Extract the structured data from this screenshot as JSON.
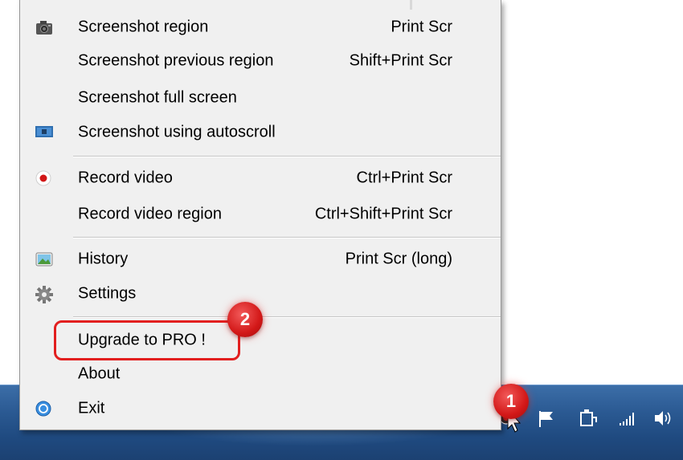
{
  "menu": {
    "items": [
      {
        "label": "Screenshot region",
        "shortcut": "Print Scr",
        "icon": "camera-icon"
      },
      {
        "label": "Screenshot previous region",
        "shortcut": "Shift+Print Scr",
        "icon": ""
      },
      {
        "label": "Screenshot full screen",
        "shortcut": "",
        "icon": ""
      },
      {
        "label": "Screenshot using autoscroll",
        "shortcut": "",
        "icon": "autoscroll-icon"
      },
      {
        "label": "Record video",
        "shortcut": "Ctrl+Print Scr",
        "icon": "record-icon"
      },
      {
        "label": "Record video region",
        "shortcut": "Ctrl+Shift+Print Scr",
        "icon": ""
      },
      {
        "label": "History",
        "shortcut": "Print Scr (long)",
        "icon": "history-icon"
      },
      {
        "label": "Settings",
        "shortcut": "",
        "icon": "gear-icon"
      },
      {
        "label": "Upgrade to PRO !",
        "shortcut": "",
        "icon": ""
      },
      {
        "label": "About",
        "shortcut": "",
        "icon": ""
      },
      {
        "label": "Exit",
        "shortcut": "",
        "icon": "exit-icon"
      }
    ]
  },
  "annotations": {
    "badge_1": "1",
    "badge_2": "2",
    "accent_color": "#e21f1f"
  },
  "taskbar": {
    "color": "#2b5a93",
    "tray_icons": [
      "show-hidden-icons-arrow",
      "network-globe-icon",
      "app-tray-icon",
      "flag-icon",
      "power-icon",
      "signal-icon",
      "volume-icon"
    ]
  }
}
